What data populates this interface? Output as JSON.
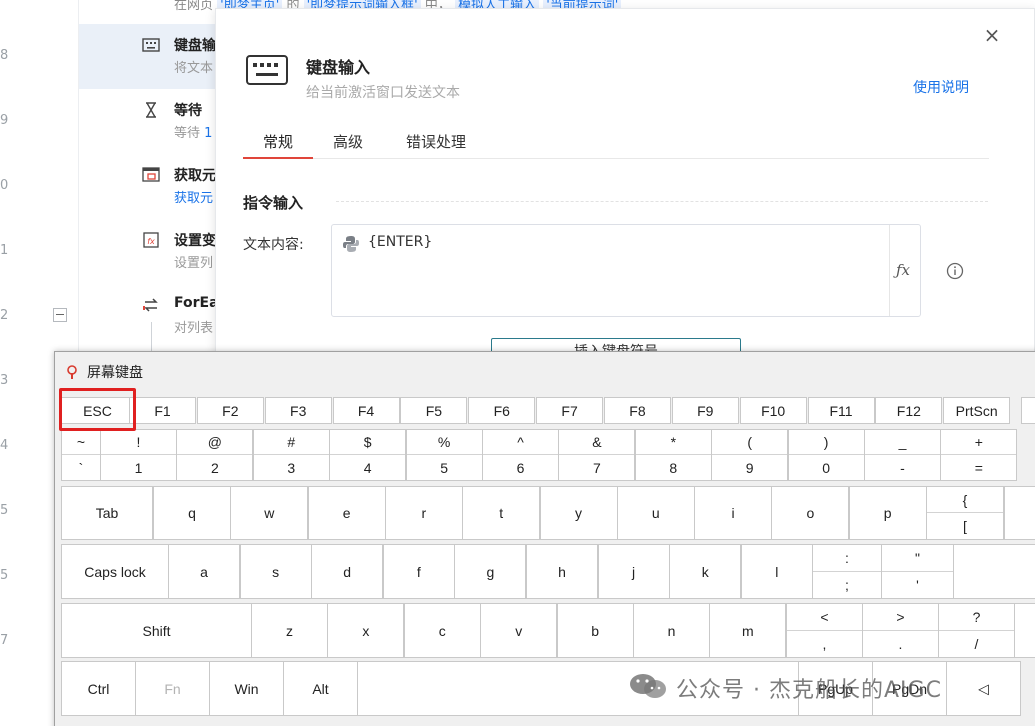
{
  "background": {
    "line_numbers": [
      "8",
      "9",
      "0",
      "1",
      "2",
      "3",
      "4",
      "5",
      "5",
      "7"
    ],
    "top_strip": {
      "prefix": "在网页",
      "tag1": "'即梦主页'",
      "mid": "的",
      "tag2": "'即梦提示词输入框'",
      "mid2": "中，",
      "tag3": "模拟人工输入",
      "tag4": "'当前提示词'"
    },
    "steps": [
      {
        "title": "键盘输",
        "sub": "将文本"
      },
      {
        "title": "等待",
        "sub_prefix": "等待",
        "sub_num": "1"
      },
      {
        "title": "获取元",
        "sub": "获取元"
      },
      {
        "title": "设置变",
        "sub": "设置列"
      },
      {
        "title": "ForEa",
        "sub": "对列表"
      }
    ]
  },
  "dialog": {
    "title": "键盘输入",
    "subtitle": "给当前激活窗口发送文本",
    "help_link": "使用说明",
    "close_icon": "×",
    "tabs": [
      {
        "label": "常规",
        "active": true
      },
      {
        "label": "高级",
        "active": false
      },
      {
        "label": "错误处理",
        "active": false
      }
    ],
    "section_title": "指令输入",
    "field_label": "文本内容:",
    "field_value": "{ENTER}",
    "fx_label": "ƒx",
    "insert_button": "插入键盘符号"
  },
  "keyboard": {
    "title": "屏幕键盘",
    "fn_row": [
      "ESC",
      "F1",
      "F2",
      "F3",
      "F4",
      "F5",
      "F6",
      "F7",
      "F8",
      "F9",
      "F10",
      "F11",
      "F12",
      "PrtScn"
    ],
    "num_row": [
      {
        "top": "~",
        "bottom": "`"
      },
      {
        "top": "!",
        "bottom": "1"
      },
      {
        "top": "@",
        "bottom": "2"
      },
      {
        "top": "#",
        "bottom": "3"
      },
      {
        "top": "$",
        "bottom": "4"
      },
      {
        "top": "%",
        "bottom": "5"
      },
      {
        "top": "^",
        "bottom": "6"
      },
      {
        "top": "&",
        "bottom": "7"
      },
      {
        "top": "*",
        "bottom": "8"
      },
      {
        "top": "(",
        "bottom": "9"
      },
      {
        "top": ")",
        "bottom": "0"
      },
      {
        "top": "_",
        "bottom": "-"
      },
      {
        "top": "+",
        "bottom": "="
      }
    ],
    "row_q": {
      "lead": "Tab",
      "keys": [
        "q",
        "w",
        "e",
        "r",
        "t",
        "y",
        "u",
        "i",
        "o",
        "p"
      ],
      "brace": {
        "top": "{",
        "bottom": "["
      }
    },
    "row_a": {
      "lead": "Caps lock",
      "keys": [
        "a",
        "s",
        "d",
        "f",
        "g",
        "h",
        "j",
        "k",
        "l"
      ],
      "colon": {
        "top": ":",
        "bottom": ";"
      },
      "quote": {
        "top": "\"",
        "bottom": "'"
      }
    },
    "row_z": {
      "lead": "Shift",
      "keys": [
        "z",
        "x",
        "c",
        "v",
        "b",
        "n",
        "m"
      ],
      "lt": {
        "top": "<",
        "bottom": ","
      },
      "gt": {
        "top": ">",
        "bottom": "."
      },
      "qm": {
        "top": "?",
        "bottom": "/"
      }
    },
    "row_bottom": {
      "ctrl": "Ctrl",
      "fn": "Fn",
      "win": "Win",
      "alt": "Alt",
      "pgup": "PgUp",
      "pgdn": "PgDn",
      "left": "◁"
    },
    "highlight_key": "ESC",
    "highlight_color": "#e02020"
  },
  "watermark": {
    "text": "公众号 · 杰克船长的AIGC"
  }
}
